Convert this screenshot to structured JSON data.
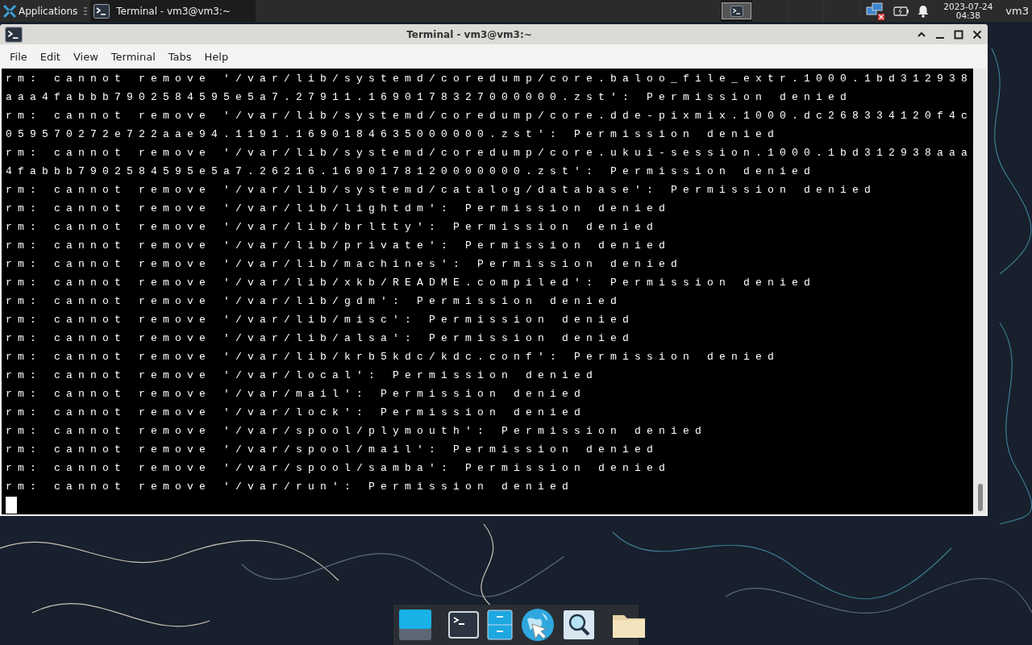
{
  "panel": {
    "apps_label": "Applications",
    "tasks": [
      {
        "title": "Terminal - vm3@vm3:~",
        "selected": true
      }
    ],
    "workspaces": [
      {
        "selected": true
      },
      {
        "selected": false
      },
      {
        "selected": false
      },
      {
        "selected": false
      }
    ],
    "clock": {
      "date": "2023-07-24",
      "time": "04:38"
    },
    "user": "vm3"
  },
  "window": {
    "title": "Terminal - vm3@vm3:~",
    "menu": [
      "File",
      "Edit",
      "View",
      "Terminal",
      "Tabs",
      "Help"
    ],
    "lines": [
      "rm: cannot remove '/var/lib/systemd/coredump/core.baloo_file_extr.1000.1bd312938",
      "aaa4fabbb7902584595e5a7.27911.1690178327000000.zst': Permission denied",
      "rm: cannot remove '/var/lib/systemd/coredump/core.dde-pixmix.1000.dc268334120f4c",
      "059570272e722aae94.1191.1690184635000000.zst': Permission denied",
      "rm: cannot remove '/var/lib/systemd/coredump/core.ukui-session.1000.1bd312938aaa",
      "4fabbb7902584595e5a7.26216.1690178120000000.zst': Permission denied",
      "rm: cannot remove '/var/lib/systemd/catalog/database': Permission denied",
      "rm: cannot remove '/var/lib/lightdm': Permission denied",
      "rm: cannot remove '/var/lib/brltty': Permission denied",
      "rm: cannot remove '/var/lib/private': Permission denied",
      "rm: cannot remove '/var/lib/machines': Permission denied",
      "rm: cannot remove '/var/lib/xkb/README.compiled': Permission denied",
      "rm: cannot remove '/var/lib/gdm': Permission denied",
      "rm: cannot remove '/var/lib/misc': Permission denied",
      "rm: cannot remove '/var/lib/alsa': Permission denied",
      "rm: cannot remove '/var/lib/krb5kdc/kdc.conf': Permission denied",
      "rm: cannot remove '/var/local': Permission denied",
      "rm: cannot remove '/var/mail': Permission denied",
      "rm: cannot remove '/var/lock': Permission denied",
      "rm: cannot remove '/var/spool/plymouth': Permission denied",
      "rm: cannot remove '/var/spool/mail': Permission denied",
      "rm: cannot remove '/var/spool/samba': Permission denied",
      "rm: cannot remove '/var/run': Permission denied"
    ]
  }
}
